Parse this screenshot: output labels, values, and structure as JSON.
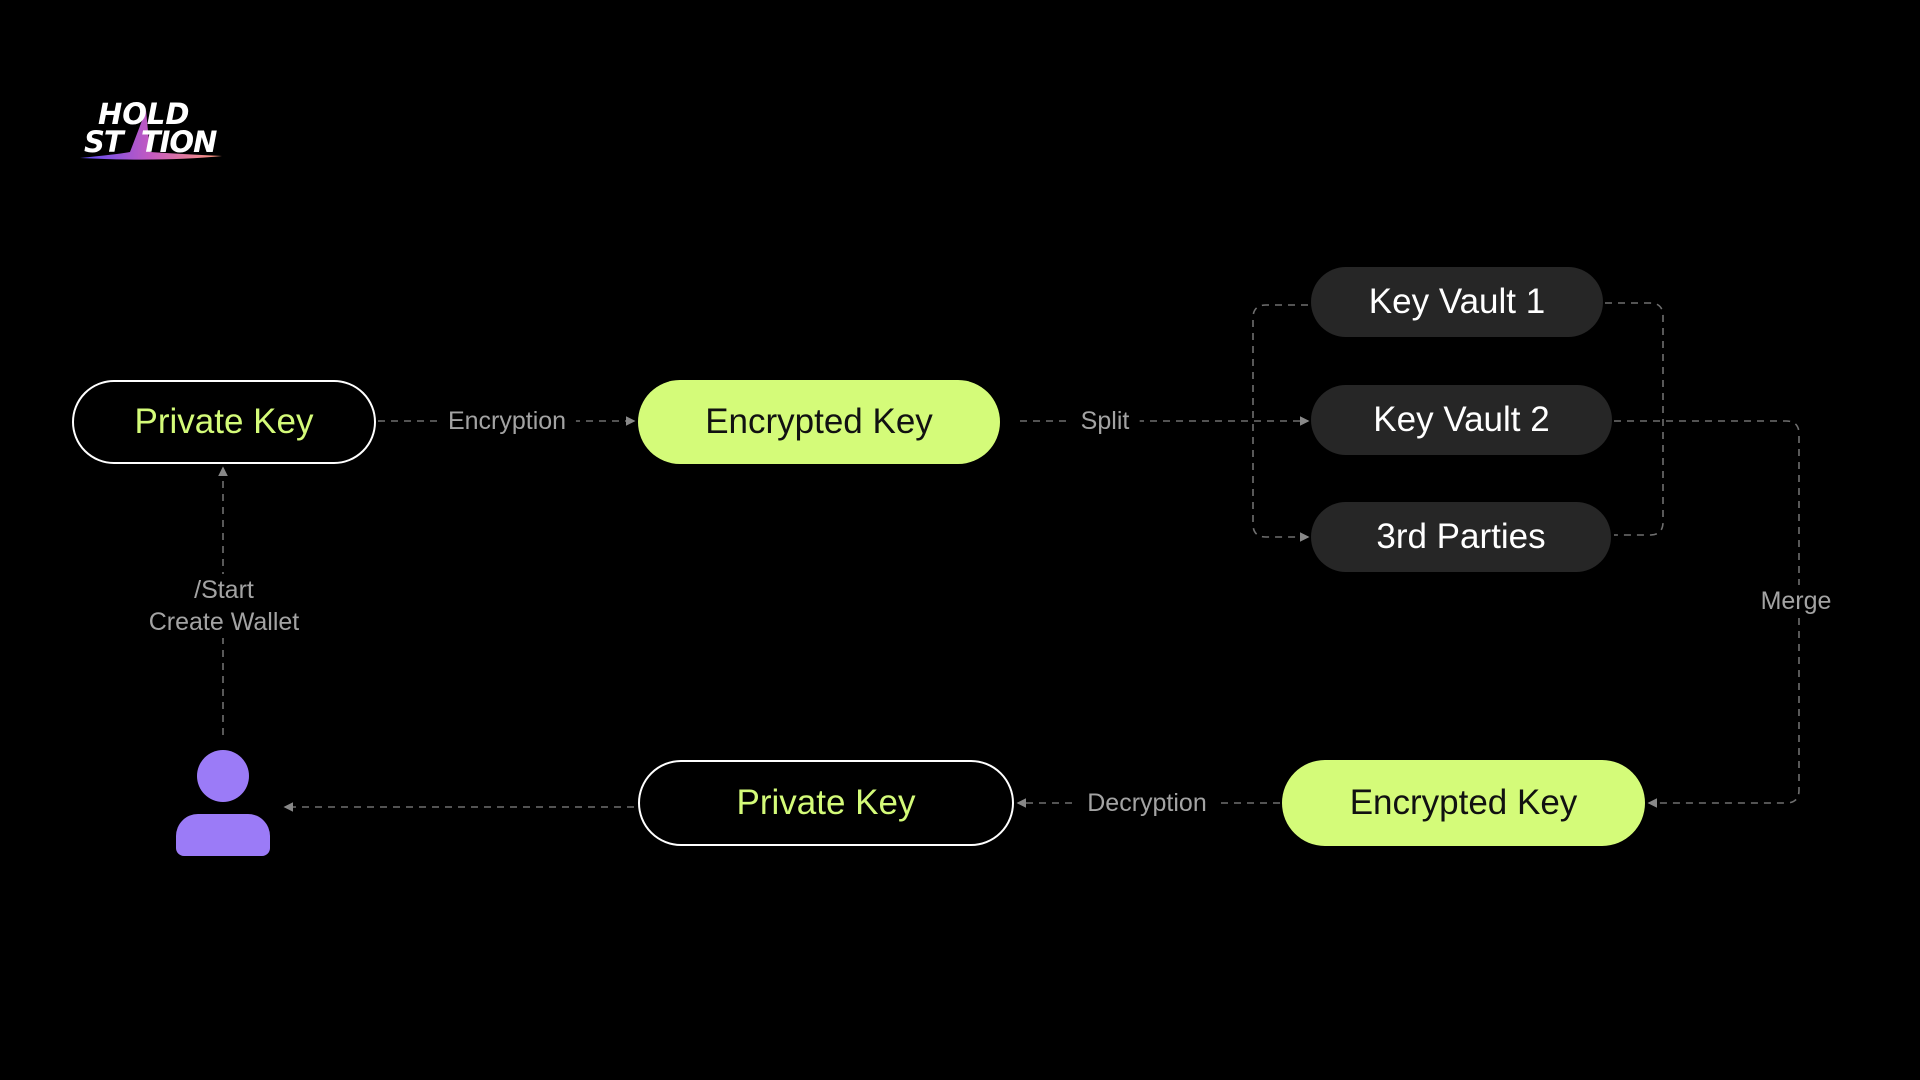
{
  "logo": {
    "text": "HOLD STATION",
    "line1": "HOLD",
    "line2": "STATION"
  },
  "nodes": {
    "private_key_top": "Private Key",
    "encrypted_key_top": "Encrypted Key",
    "key_vault_1": "Key Vault 1",
    "key_vault_2": "Key Vault 2",
    "third_parties": "3rd Parties",
    "encrypted_key_bottom": "Encrypted Key",
    "private_key_bottom": "Private Key"
  },
  "edges": {
    "encryption": "Encryption",
    "split": "Split",
    "merge": "Merge",
    "decryption": "Decryption",
    "start_line1": "/Start",
    "start_line2": "Create Wallet"
  },
  "icons": {
    "user": "user-icon"
  },
  "colors": {
    "accent": "#d4fb79",
    "node_dark": "#262626",
    "user": "#9b7bf7",
    "line": "#777777"
  }
}
